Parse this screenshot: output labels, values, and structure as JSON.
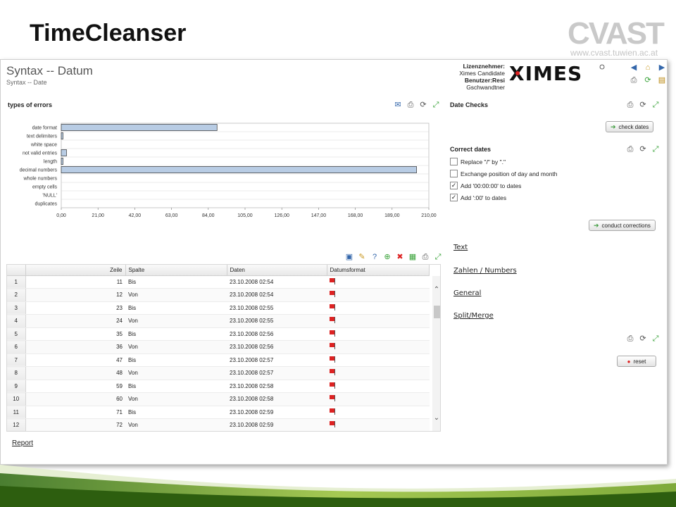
{
  "slide": {
    "title": "TimeCleanser",
    "logo_text": "CVAST",
    "logo_url": "www.cvast.tuwien.ac.at"
  },
  "app": {
    "title": "Syntax -- Datum",
    "subtitle": "Syntax -- Date",
    "license": {
      "line1": "Lizenznehmer:",
      "line2": "Ximes Candidate",
      "line3": "Benutzer:Resi",
      "line4": "Gschwandtner"
    },
    "brand": "XIMES"
  },
  "errors_panel": {
    "title": "types of errors"
  },
  "chart_data": {
    "type": "bar",
    "orientation": "horizontal",
    "categories": [
      "date format",
      "text delimiters",
      "white space",
      "not valid entries",
      "length",
      "decimal numbers",
      "whole numbers",
      "empty cells",
      "'NULL'",
      "duplicates"
    ],
    "values": [
      89,
      1,
      0,
      3,
      1,
      203,
      0,
      0,
      0,
      0
    ],
    "xlim": [
      0,
      210
    ],
    "xticks": [
      "0,00",
      "21,00",
      "42,00",
      "63,00",
      "84,00",
      "105,00",
      "126,00",
      "147,00",
      "168,00",
      "189,00",
      "210,00"
    ],
    "grid": true,
    "colors": {
      "bar": "#b8cce4",
      "bar_border": "#333333"
    }
  },
  "table": {
    "columns": [
      "",
      "Zeile",
      "Spalte",
      "Daten",
      "Datumsformat"
    ],
    "rows": [
      {
        "n": "1",
        "zeile": "11",
        "spalte": "Bis",
        "daten": "23.10.2008 02:54"
      },
      {
        "n": "2",
        "zeile": "12",
        "spalte": "Von",
        "daten": "23.10.2008 02:54"
      },
      {
        "n": "3",
        "zeile": "23",
        "spalte": "Bis",
        "daten": "23.10.2008 02:55"
      },
      {
        "n": "4",
        "zeile": "24",
        "spalte": "Von",
        "daten": "23.10.2008 02:55"
      },
      {
        "n": "5",
        "zeile": "35",
        "spalte": "Bis",
        "daten": "23.10.2008 02:56"
      },
      {
        "n": "6",
        "zeile": "36",
        "spalte": "Von",
        "daten": "23.10.2008 02:56"
      },
      {
        "n": "7",
        "zeile": "47",
        "spalte": "Bis",
        "daten": "23.10.2008 02:57"
      },
      {
        "n": "8",
        "zeile": "48",
        "spalte": "Von",
        "daten": "23.10.2008 02:57"
      },
      {
        "n": "9",
        "zeile": "59",
        "spalte": "Bis",
        "daten": "23.10.2008 02:58"
      },
      {
        "n": "10",
        "zeile": "60",
        "spalte": "Von",
        "daten": "23.10.2008 02:58"
      },
      {
        "n": "11",
        "zeile": "71",
        "spalte": "Bis",
        "daten": "23.10.2008 02:59"
      },
      {
        "n": "12",
        "zeile": "72",
        "spalte": "Von",
        "daten": "23.10.2008 02:59"
      }
    ]
  },
  "report_link": "Report",
  "date_checks": {
    "title": "Date Checks",
    "button": "check dates"
  },
  "correct_dates": {
    "title": "Correct dates",
    "options": [
      {
        "label": "Replace \"/\" by \".\"",
        "checked": false
      },
      {
        "label": "Exchange position of day and month",
        "checked": false
      },
      {
        "label": "Add '00:00:00' to dates",
        "checked": true
      },
      {
        "label": "Add ':00' to dates",
        "checked": true
      }
    ],
    "button": "conduct corrections"
  },
  "side_links": [
    "Text",
    "Zahlen / Numbers",
    "General",
    "Split/Merge"
  ],
  "reset_button": "reset",
  "icons": {
    "nav": [
      "arrow-left-icon",
      "home-icon",
      "arrow-right-icon"
    ],
    "nav2": [
      "print-icon",
      "refresh-icon",
      "export-icon"
    ],
    "panel_tools": [
      "comment-icon",
      "print-icon",
      "refresh-icon",
      "maximize-icon"
    ],
    "table_tools": [
      "save-icon",
      "edit-icon",
      "help-icon",
      "add-icon",
      "delete-icon",
      "excel-icon",
      "print-icon",
      "maximize-icon"
    ]
  }
}
